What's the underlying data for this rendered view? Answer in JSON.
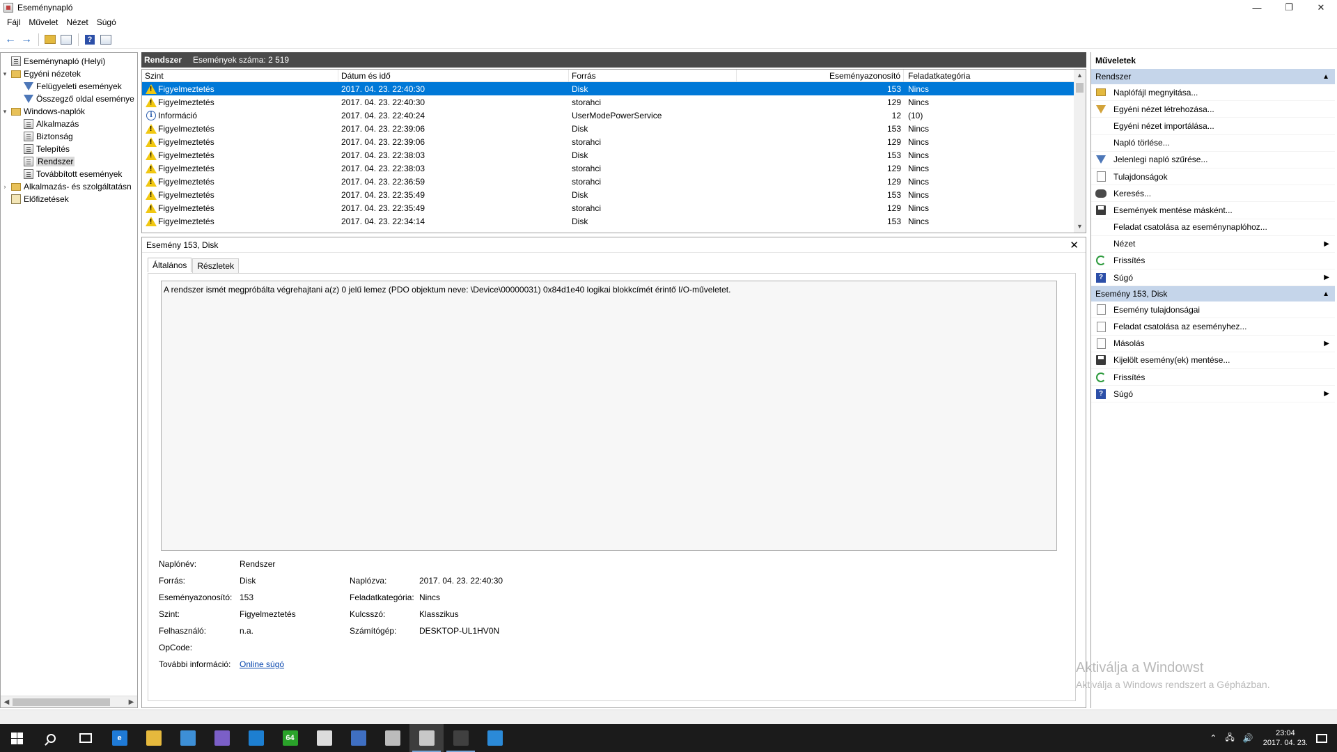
{
  "window": {
    "title": "Eseménynapló",
    "controls": {
      "minimize": "—",
      "maximize": "❐",
      "close": "✕"
    }
  },
  "menu": [
    "Fájl",
    "Művelet",
    "Nézet",
    "Súgó"
  ],
  "tree": [
    {
      "label": "Eseménynapló (Helyi)",
      "depth": 0,
      "icon": "log-icon",
      "toggle": ""
    },
    {
      "label": "Egyéni nézetek",
      "depth": 0,
      "icon": "folder-icon",
      "toggle": "▾"
    },
    {
      "label": "Felügyeleti események",
      "depth": 1,
      "icon": "filter-icon",
      "toggle": ""
    },
    {
      "label": "Összegző oldal eseménye",
      "depth": 1,
      "icon": "filter-icon",
      "toggle": ""
    },
    {
      "label": "Windows-naplók",
      "depth": 0,
      "icon": "folder-icon",
      "toggle": "▾"
    },
    {
      "label": "Alkalmazás",
      "depth": 1,
      "icon": "log-icon",
      "toggle": ""
    },
    {
      "label": "Biztonság",
      "depth": 1,
      "icon": "log-icon",
      "toggle": ""
    },
    {
      "label": "Telepítés",
      "depth": 1,
      "icon": "log-icon",
      "toggle": ""
    },
    {
      "label": "Rendszer",
      "depth": 1,
      "icon": "log-icon",
      "toggle": "",
      "selected": true
    },
    {
      "label": "Továbbított események",
      "depth": 1,
      "icon": "log-icon",
      "toggle": ""
    },
    {
      "label": "Alkalmazás- és szolgáltatásn",
      "depth": 0,
      "icon": "folder-icon",
      "toggle": "›"
    },
    {
      "label": "Előfizetések",
      "depth": 0,
      "icon": "subscription-icon",
      "toggle": ""
    }
  ],
  "log_header": {
    "name": "Rendszer",
    "count_label": "Események száma: 2 519"
  },
  "columns": [
    "Szint",
    "Dátum és idő",
    "Forrás",
    "Eseményazonosító",
    "Feladatkategória"
  ],
  "events": [
    {
      "level": "Figyelmeztetés",
      "type": "warning",
      "date": "2017. 04. 23. 22:40:30",
      "source": "Disk",
      "id": "153",
      "category": "Nincs",
      "selected": true
    },
    {
      "level": "Figyelmeztetés",
      "type": "warning",
      "date": "2017. 04. 23. 22:40:30",
      "source": "storahci",
      "id": "129",
      "category": "Nincs"
    },
    {
      "level": "Információ",
      "type": "info",
      "date": "2017. 04. 23. 22:40:24",
      "source": "UserModePowerService",
      "id": "12",
      "category": "(10)"
    },
    {
      "level": "Figyelmeztetés",
      "type": "warning",
      "date": "2017. 04. 23. 22:39:06",
      "source": "Disk",
      "id": "153",
      "category": "Nincs"
    },
    {
      "level": "Figyelmeztetés",
      "type": "warning",
      "date": "2017. 04. 23. 22:39:06",
      "source": "storahci",
      "id": "129",
      "category": "Nincs"
    },
    {
      "level": "Figyelmeztetés",
      "type": "warning",
      "date": "2017. 04. 23. 22:38:03",
      "source": "Disk",
      "id": "153",
      "category": "Nincs"
    },
    {
      "level": "Figyelmeztetés",
      "type": "warning",
      "date": "2017. 04. 23. 22:38:03",
      "source": "storahci",
      "id": "129",
      "category": "Nincs"
    },
    {
      "level": "Figyelmeztetés",
      "type": "warning",
      "date": "2017. 04. 23. 22:36:59",
      "source": "storahci",
      "id": "129",
      "category": "Nincs"
    },
    {
      "level": "Figyelmeztetés",
      "type": "warning",
      "date": "2017. 04. 23. 22:35:49",
      "source": "Disk",
      "id": "153",
      "category": "Nincs"
    },
    {
      "level": "Figyelmeztetés",
      "type": "warning",
      "date": "2017. 04. 23. 22:35:49",
      "source": "storahci",
      "id": "129",
      "category": "Nincs"
    },
    {
      "level": "Figyelmeztetés",
      "type": "warning",
      "date": "2017. 04. 23. 22:34:14",
      "source": "Disk",
      "id": "153",
      "category": "Nincs"
    }
  ],
  "detail": {
    "title": "Esemény 153, Disk",
    "tabs": [
      "Általános",
      "Részletek"
    ],
    "description": "A rendszer ismét megpróbálta végrehajtani a(z) 0 jelű lemez (PDO objektum neve: \\Device\\00000031) 0x84d1e40 logikai blokkcímét érintő I/O-műveletet.",
    "props": {
      "naplonev_label": "Naplónév:",
      "naplonev": "Rendszer",
      "forras_label": "Forrás:",
      "forras": "Disk",
      "naplozva_label": "Naplózva:",
      "naplozva": "2017. 04. 23. 22:40:30",
      "azonosito_label": "Eseményazonosító:",
      "azonosito": "153",
      "kategoria_label": "Feladatkategória:",
      "kategoria": "Nincs",
      "szint_label": "Szint:",
      "szint": "Figyelmeztetés",
      "kulcsszo_label": "Kulcsszó:",
      "kulcsszo": "Klasszikus",
      "felhasznalo_label": "Felhasználó:",
      "felhasznalo": "n.a.",
      "szamitogep_label": "Számítógép:",
      "szamitogep": "DESKTOP-UL1HV0N",
      "opcode_label": "OpCode:",
      "opcode": "",
      "tovabbi_label": "További információ:",
      "tovabbi_link": "Online súgó"
    }
  },
  "actions": {
    "title": "Műveletek",
    "section1": "Rendszer",
    "items1": [
      {
        "label": "Naplófájl megnyitása...",
        "icon": "folder-open-icon"
      },
      {
        "label": "Egyéni nézet létrehozása...",
        "icon": "filter-create-icon"
      },
      {
        "label": "Egyéni nézet importálása...",
        "icon": "none"
      },
      {
        "label": "Napló törlése...",
        "icon": "none"
      },
      {
        "label": "Jelenlegi napló szűrése...",
        "icon": "filter-icon"
      },
      {
        "label": "Tulajdonságok",
        "icon": "properties-icon"
      },
      {
        "label": "Keresés...",
        "icon": "binoculars-icon"
      },
      {
        "label": "Események mentése másként...",
        "icon": "save-icon"
      },
      {
        "label": "Feladat csatolása az eseménynaplóhoz...",
        "icon": "none"
      },
      {
        "label": "Nézet",
        "icon": "none",
        "submenu": true
      },
      {
        "label": "Frissítés",
        "icon": "refresh-icon"
      },
      {
        "label": "Súgó",
        "icon": "help-icon",
        "submenu": true
      }
    ],
    "section2": "Esemény 153, Disk",
    "items2": [
      {
        "label": "Esemény tulajdonságai",
        "icon": "properties-icon"
      },
      {
        "label": "Feladat csatolása az eseményhez...",
        "icon": "task-icon"
      },
      {
        "label": "Másolás",
        "icon": "copy-icon",
        "submenu": true
      },
      {
        "label": "Kijelölt esemény(ek) mentése...",
        "icon": "save-icon"
      },
      {
        "label": "Frissítés",
        "icon": "refresh-icon"
      },
      {
        "label": "Súgó",
        "icon": "help-icon",
        "submenu": true
      }
    ]
  },
  "watermark": {
    "line1": "Aktiválja a Windowst",
    "line2": "Aktiválja a Windows rendszert a Gépházban."
  },
  "taskbar": {
    "apps": [
      {
        "name": "edge-icon",
        "color": "#1f7ad6",
        "label": "e"
      },
      {
        "name": "file-explorer-icon",
        "color": "#e6b93d",
        "label": ""
      },
      {
        "name": "monitor-icon",
        "color": "#3d8fd6",
        "label": ""
      },
      {
        "name": "cpu-icon",
        "color": "#7b5fc7",
        "label": ""
      },
      {
        "name": "store-icon",
        "color": "#1d7fd1",
        "label": ""
      },
      {
        "name": "hwinfo64-icon",
        "color": "#2aa32a",
        "label": "64"
      },
      {
        "name": "calculator-icon",
        "color": "#dcdcdc",
        "label": ""
      },
      {
        "name": "floppy-icon",
        "color": "#3f6fc2",
        "label": ""
      },
      {
        "name": "printer-icon",
        "color": "#bcbcbc",
        "label": ""
      },
      {
        "name": "event-viewer-icon",
        "color": "#c8c8c8",
        "label": ""
      },
      {
        "name": "disk-tool-icon",
        "color": "#404040",
        "label": ""
      },
      {
        "name": "network-tool-icon",
        "color": "#2b8ad8",
        "label": ""
      }
    ],
    "clock_time": "23:04",
    "clock_date": "2017. 04. 23."
  }
}
